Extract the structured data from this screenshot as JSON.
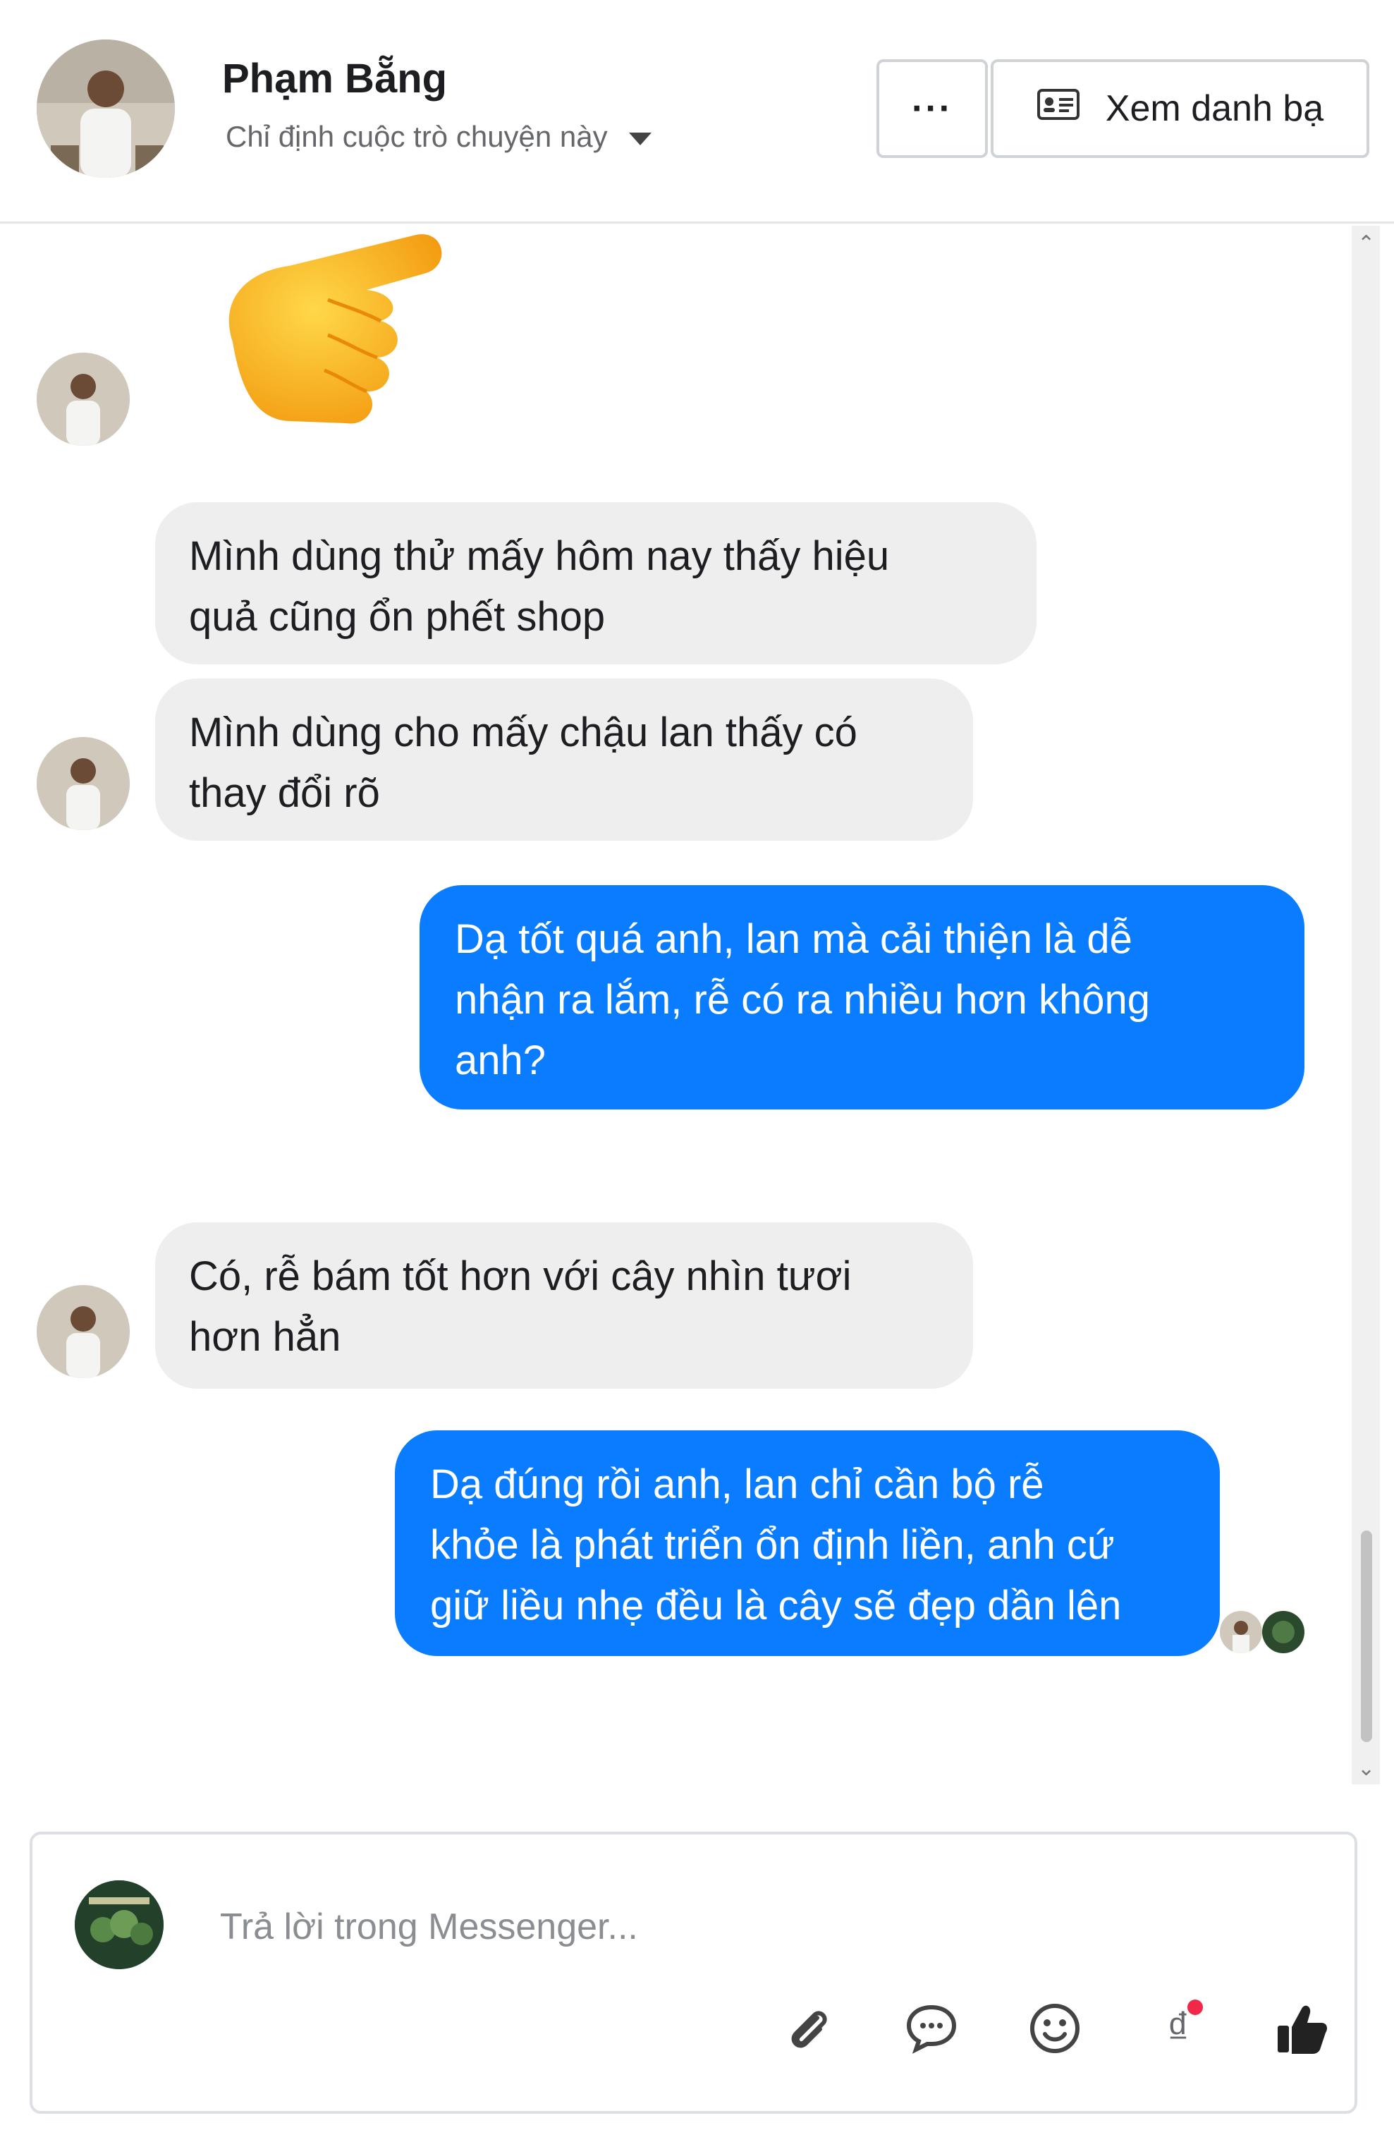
{
  "header": {
    "name": "Phạm Bẵng",
    "subtitle": "Chỉ định cuộc trò chuyện này",
    "more_label": "···",
    "contacts_label": "Xem danh bạ"
  },
  "messages": [
    {
      "from": "them",
      "lines": [
        "Mình dùng thử mấy hôm nay thấy hiệu",
        "quả cũng ổn phết shop"
      ]
    },
    {
      "from": "them",
      "lines": [
        "Mình dùng cho mấy chậu lan thấy có",
        "thay đổi rõ"
      ]
    },
    {
      "from": "me",
      "lines": [
        "Dạ tốt quá anh, lan mà cải thiện là dễ",
        "nhận ra lắm, rễ có ra nhiều hơn không",
        "anh?"
      ]
    },
    {
      "from": "them",
      "lines": [
        "Có, rễ bám tốt hơn với cây nhìn tươi",
        "hơn hẳn"
      ]
    },
    {
      "from": "me",
      "lines": [
        "Dạ đúng rồi anh, lan chỉ cần bộ rễ",
        "khỏe là phát triển ổn định liền, anh cứ",
        "giữ liều nhẹ đều là cây sẽ đẹp dần lên"
      ]
    }
  ],
  "composer": {
    "placeholder": "Trả lời trong Messenger...",
    "currency_symbol": "₫"
  },
  "icons": {
    "more": "more-icon",
    "contacts": "contact-card-icon",
    "attach": "paperclip-icon",
    "chat": "chat-bubble-icon",
    "emoji": "smiley-icon",
    "currency": "currency-icon",
    "like": "thumbs-up-icon",
    "sticker": "pointing-hand-icon"
  },
  "colors": {
    "outgoing_bubble": "#0a7cff",
    "incoming_bubble": "#eeeeee",
    "notification_dot": "#f02849"
  }
}
